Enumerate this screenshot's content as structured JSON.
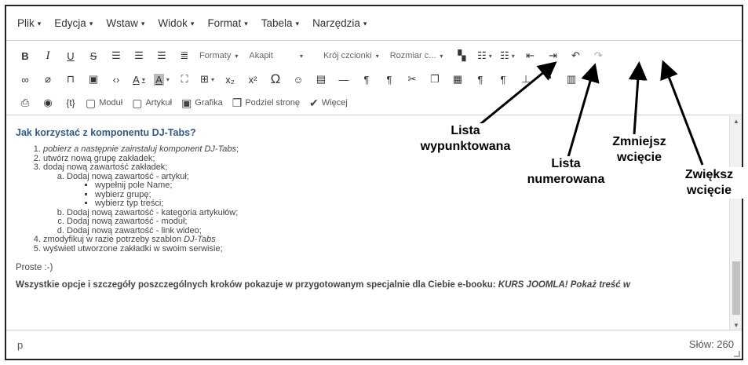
{
  "menu": [
    "Plik",
    "Edycja",
    "Wstaw",
    "Widok",
    "Format",
    "Tabela",
    "Narzędzia"
  ],
  "toolbar": {
    "bold": "B",
    "italic": "I",
    "underline": "U",
    "strike": "S",
    "formats": "Formaty",
    "block": "Akapit",
    "font_family": "Krój czcionki",
    "font_size": "Rozmiar c...",
    "subscript": "x₂",
    "superscript": "x²",
    "omega": "Ω",
    "embed": "{t}",
    "module": "Moduł",
    "article": "Artykuł",
    "image": "Grafika",
    "pagebreak": "Podziel stronę",
    "more": "Więcej"
  },
  "content": {
    "heading": "Jak korzystać z komponentu DJ-Tabs?",
    "step1_pre": "pobierz a następnie zainstaluj komponent ",
    "step1_em": "DJ-Tabs",
    "step1_post": ";",
    "step2": "utwórz nową grupę zakładek;",
    "step3": "dodaj nową zawartość zakładek;",
    "sub_a": "Dodaj nową zawartość - artykuł;",
    "sub_a_items": [
      "wypełnij pole Name;",
      "wybierz grupę;",
      "wybierz typ treści;"
    ],
    "sub_b": "Dodaj nową zawartość - kategoria artykułów;",
    "sub_c": "Dodaj nową zawartość - moduł;",
    "sub_d": "Dodaj nową zawartość - link wideo;",
    "step4_pre": "zmodyfikuj w razie potrzeby szablon ",
    "step4_em": "DJ-Tabs",
    "step5": "wyświetl utworzone zakładki w swoim serwisie;",
    "proste": "Proste :-)",
    "last_line": "Wszystkie opcje i szczegóły poszczególnych kroków pokazuje w przygotowanym specjalnie dla Ciebie e-booku: ",
    "last_em": "KURS JOOMLA! Pokaż treść w"
  },
  "status": {
    "path": "p",
    "word_count": "Słów: 260"
  },
  "annotations": {
    "bullet_list": "Lista\nwypunktowana",
    "numbered_list": "Lista\nnumerowana",
    "outdent": "Zmniejsz\nwcięcie",
    "indent": "Zwiększ\nwcięcie"
  }
}
